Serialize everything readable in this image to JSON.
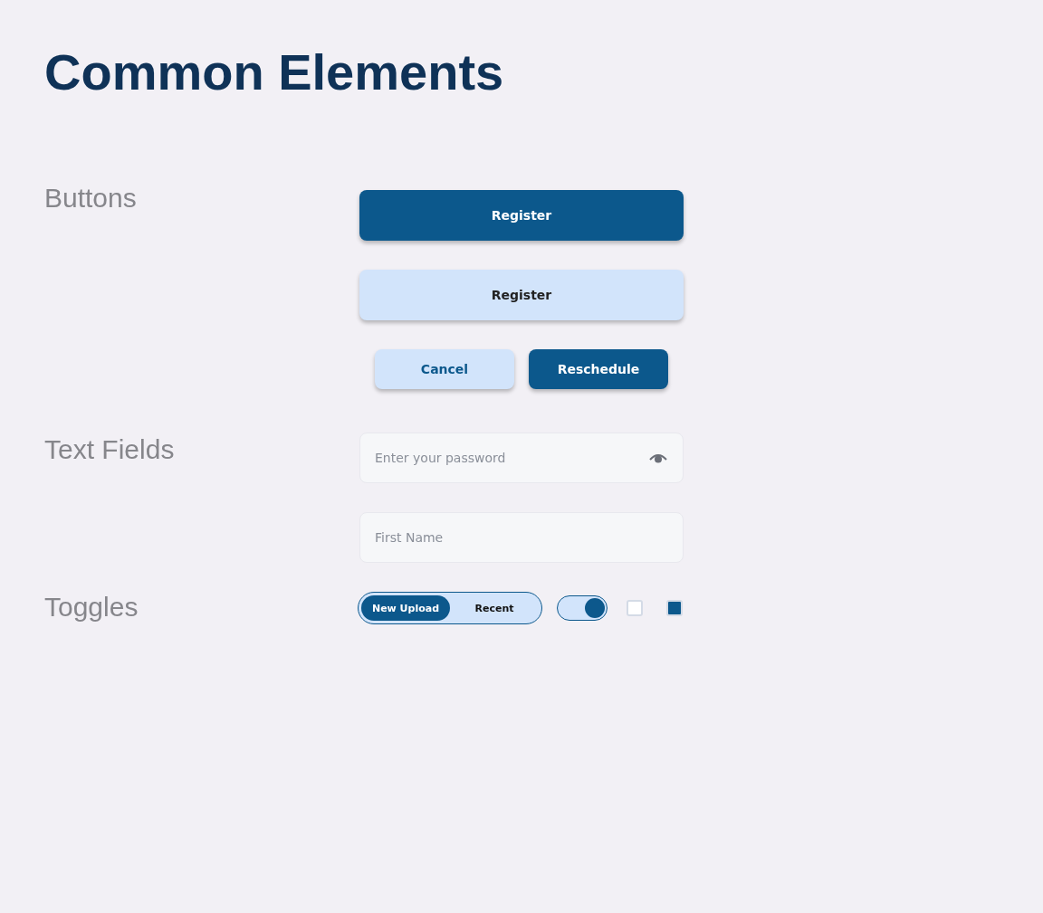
{
  "title": "Common Elements",
  "sections": [
    {
      "label": "Buttons"
    },
    {
      "label": "Text Fields"
    },
    {
      "label": "Toggles"
    }
  ],
  "buttons": [
    {
      "label": "Register",
      "kind": "primary"
    },
    {
      "label": "Register",
      "kind": "secondary"
    }
  ],
  "button_pair": [
    {
      "label": "Cancel",
      "kind": "secondary"
    },
    {
      "label": "Reschedule",
      "kind": "primary"
    }
  ],
  "fields": [
    {
      "placeholder": "Enter your password",
      "kind": "password"
    },
    {
      "placeholder": "First Name",
      "kind": "text"
    }
  ],
  "segmented": [
    {
      "label": "New Upload",
      "selected": true
    },
    {
      "label": "Recent",
      "selected": false
    }
  ],
  "switch": {
    "on": true
  },
  "checkboxes": [
    {
      "checked": false
    },
    {
      "checked": true
    }
  ]
}
